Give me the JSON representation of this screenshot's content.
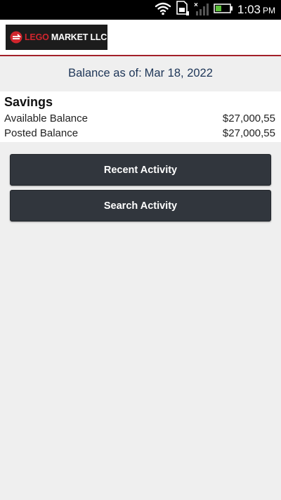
{
  "status_bar": {
    "time": "1:03",
    "ampm": "PM"
  },
  "header": {
    "logo_text_red": "LEGO",
    "logo_text_white": " MARKET LLC"
  },
  "balance_as_of": {
    "label": "Balance as of:",
    "date": "Mar 18, 2022"
  },
  "account": {
    "name": "Savings",
    "rows": [
      {
        "label": "Available Balance",
        "value": "$27,000,55"
      },
      {
        "label": "Posted Balance",
        "value": "$27,000,55"
      }
    ]
  },
  "actions": {
    "recent_label": "Recent Activity",
    "search_label": "Search Activity"
  },
  "colors": {
    "header_rule": "#a3202a",
    "button_bg": "#31363d",
    "date_text": "#1d3557",
    "logo_red": "#d0252d"
  },
  "icons": [
    "wifi-icon",
    "sim-card-icon",
    "signal-icon",
    "battery-icon",
    "logo-mark-icon"
  ]
}
